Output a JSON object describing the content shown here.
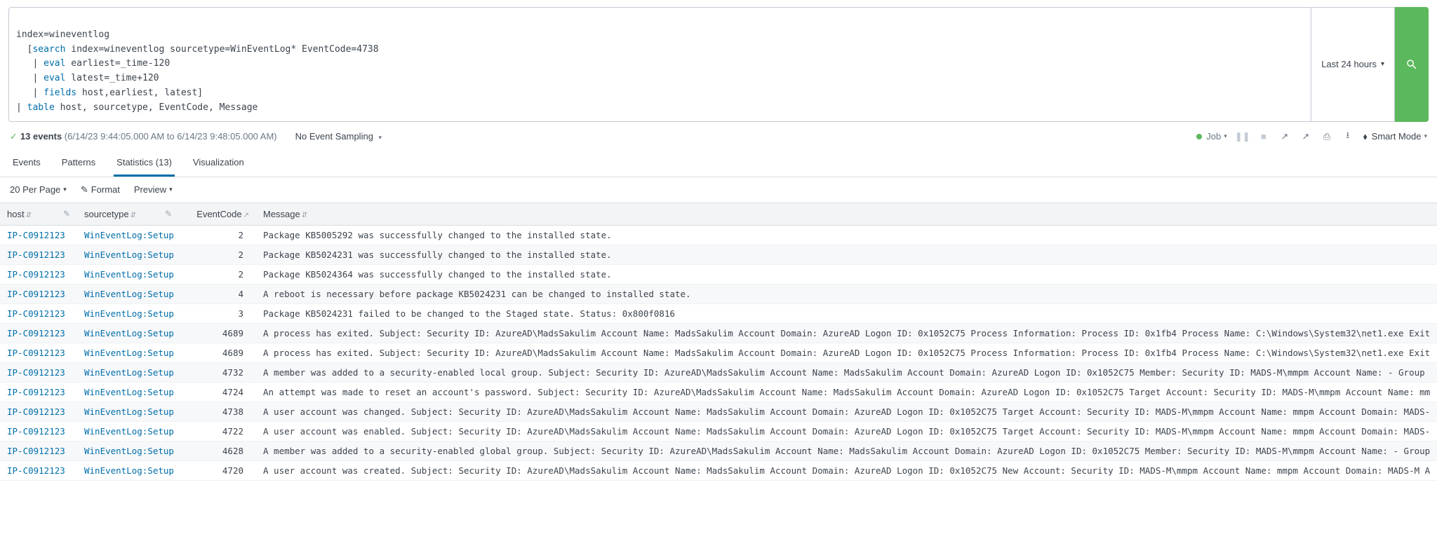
{
  "search": {
    "line1_prefix": "index=wineventlog",
    "line2_bracket_open": "  [",
    "line2_kw": "search",
    "line2_rest": " index=wineventlog sourcetype=WinEventLog* EventCode=4738",
    "line3_pipe": "   | ",
    "line3_kw": "eval",
    "line3_rest": " earliest=_time-120",
    "line4_pipe": "   | ",
    "line4_kw": "eval",
    "line4_rest": " latest=_time+120",
    "line5_pipe": "   | ",
    "line5_kw": "fields",
    "line5_rest": " host,earliest, latest]",
    "line6_pipe": "| ",
    "line6_kw": "table",
    "line6_rest": " host, sourcetype, EventCode, Message",
    "time_picker": "Last 24 hours"
  },
  "status": {
    "checkmark": "✓",
    "events_bold": "13 events",
    "range": "(6/14/23 9:44:05.000 AM to 6/14/23 9:48:05.000 AM)",
    "sampling": "No Event Sampling",
    "job_label": "Job",
    "pause_icon": "❚❚",
    "stop_icon": "■",
    "reload_icon": "↻",
    "share_icon": "↗",
    "print_icon": "⎙",
    "download_icon": "⭳",
    "bolt_icon": "⬧",
    "smart_mode": "Smart Mode"
  },
  "tabs": {
    "events": "Events",
    "patterns": "Patterns",
    "statistics": "Statistics (13)",
    "visualization": "Visualization"
  },
  "toolbar": {
    "per_page": "20 Per Page",
    "format": "Format",
    "preview": "Preview",
    "pencil_icon": "✎"
  },
  "table": {
    "headers": {
      "host": "host",
      "sourcetype": "sourcetype",
      "eventcode": "EventCode",
      "message": "Message",
      "sort_both": "⇵",
      "sort_asc": "↗",
      "pencil": "✎"
    },
    "rows": [
      {
        "host": "IP-C0912123",
        "sourcetype": "WinEventLog:Setup",
        "eventcode": "2",
        "message": "Package KB5005292 was successfully changed to the installed state."
      },
      {
        "host": "IP-C0912123",
        "sourcetype": "WinEventLog:Setup",
        "eventcode": "2",
        "message": "Package KB5024231 was successfully changed to the installed state."
      },
      {
        "host": "IP-C0912123",
        "sourcetype": "WinEventLog:Setup",
        "eventcode": "2",
        "message": "Package KB5024364 was successfully changed to the installed state."
      },
      {
        "host": "IP-C0912123",
        "sourcetype": "WinEventLog:Setup",
        "eventcode": "4",
        "message": "A reboot is necessary before package KB5024231 can be changed to installed state."
      },
      {
        "host": "IP-C0912123",
        "sourcetype": "WinEventLog:Setup",
        "eventcode": "3",
        "message": "Package KB5024231 failed to be changed to the Staged state. Status: 0x800f0816"
      },
      {
        "host": "IP-C0912123",
        "sourcetype": "WinEventLog:Setup",
        "eventcode": "4689",
        "message": "A process has exited. Subject: Security ID: AzureAD\\MadsSakulim Account Name: MadsSakulim Account Domain: AzureAD Logon ID: 0x1052C75 Process Information: Process ID: 0x1fb4 Process Name: C:\\Windows\\System32\\net1.exe Exit"
      },
      {
        "host": "IP-C0912123",
        "sourcetype": "WinEventLog:Setup",
        "eventcode": "4689",
        "message": "A process has exited. Subject: Security ID: AzureAD\\MadsSakulim Account Name: MadsSakulim Account Domain: AzureAD Logon ID: 0x1052C75 Process Information: Process ID: 0x1fb4 Process Name: C:\\Windows\\System32\\net1.exe Exit"
      },
      {
        "host": "IP-C0912123",
        "sourcetype": "WinEventLog:Setup",
        "eventcode": "4732",
        "message": "A member was added to a security-enabled local group. Subject: Security ID: AzureAD\\MadsSakulim Account Name: MadsSakulim Account Domain: AzureAD Logon ID: 0x1052C75 Member: Security ID: MADS-M\\mmpm Account Name: - Group"
      },
      {
        "host": "IP-C0912123",
        "sourcetype": "WinEventLog:Setup",
        "eventcode": "4724",
        "message": "An attempt was made to reset an account's password. Subject: Security ID: AzureAD\\MadsSakulim Account Name: MadsSakulim Account Domain: AzureAD Logon ID: 0x1052C75 Target Account: Security ID: MADS-M\\mmpm Account Name: mm"
      },
      {
        "host": "IP-C0912123",
        "sourcetype": "WinEventLog:Setup",
        "eventcode": "4738",
        "message": "A user account was changed. Subject: Security ID: AzureAD\\MadsSakulim Account Name: MadsSakulim Account Domain: AzureAD Logon ID: 0x1052C75 Target Account: Security ID: MADS-M\\mmpm Account Name: mmpm Account Domain: MADS-"
      },
      {
        "host": "IP-C0912123",
        "sourcetype": "WinEventLog:Setup",
        "eventcode": "4722",
        "message": "A user account was enabled. Subject: Security ID: AzureAD\\MadsSakulim Account Name: MadsSakulim Account Domain: AzureAD Logon ID: 0x1052C75 Target Account: Security ID: MADS-M\\mmpm Account Name: mmpm Account Domain: MADS-"
      },
      {
        "host": "IP-C0912123",
        "sourcetype": "WinEventLog:Setup",
        "eventcode": "4628",
        "message": "A member was added to a security-enabled global group. Subject: Security ID: AzureAD\\MadsSakulim Account Name: MadsSakulim Account Domain: AzureAD Logon ID: 0x1052C75 Member: Security ID: MADS-M\\mmpm Account Name: - Group"
      },
      {
        "host": "IP-C0912123",
        "sourcetype": "WinEventLog:Setup",
        "eventcode": "4720",
        "message": "A user account was created. Subject: Security ID: AzureAD\\MadsSakulim Account Name: MadsSakulim Account Domain: AzureAD Logon ID: 0x1052C75 New Account: Security ID: MADS-M\\mmpm Account Name: mmpm Account Domain: MADS-M A"
      }
    ]
  }
}
